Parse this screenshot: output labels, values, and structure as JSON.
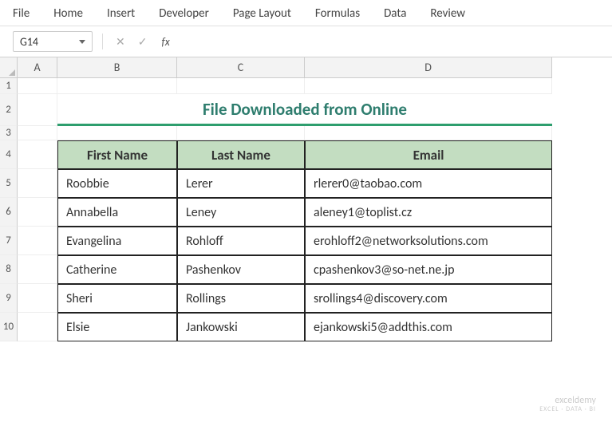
{
  "ribbon": {
    "tabs": [
      "File",
      "Home",
      "Insert",
      "Developer",
      "Page Layout",
      "Formulas",
      "Data",
      "Review"
    ]
  },
  "namebox": {
    "value": "G14"
  },
  "formula": {
    "value": ""
  },
  "columns": [
    "A",
    "B",
    "C",
    "D"
  ],
  "row_numbers": [
    "1",
    "2",
    "3",
    "4",
    "5",
    "6",
    "7",
    "8",
    "9",
    "10"
  ],
  "sheet_title": "File Downloaded from Online",
  "table": {
    "headers": {
      "first": "First Name",
      "last": "Last Name",
      "email": "Email"
    },
    "rows": [
      {
        "first": "Roobbie",
        "last": "Lerer",
        "email": "rlerer0@taobao.com"
      },
      {
        "first": "Annabella",
        "last": "Leney",
        "email": "aleney1@toplist.cz"
      },
      {
        "first": "Evangelina",
        "last": "Rohloff",
        "email": "erohloff2@networksolutions.com"
      },
      {
        "first": "Catherine",
        "last": "Pashenkov",
        "email": "cpashenkov3@so-net.ne.jp"
      },
      {
        "first": "Sheri",
        "last": "Rollings",
        "email": "srollings4@discovery.com"
      },
      {
        "first": "Elsie",
        "last": "Jankowski",
        "email": "ejankowski5@addthis.com"
      }
    ]
  },
  "watermark": {
    "main": "exceldemy",
    "sub": "EXCEL · DATA · BI"
  }
}
